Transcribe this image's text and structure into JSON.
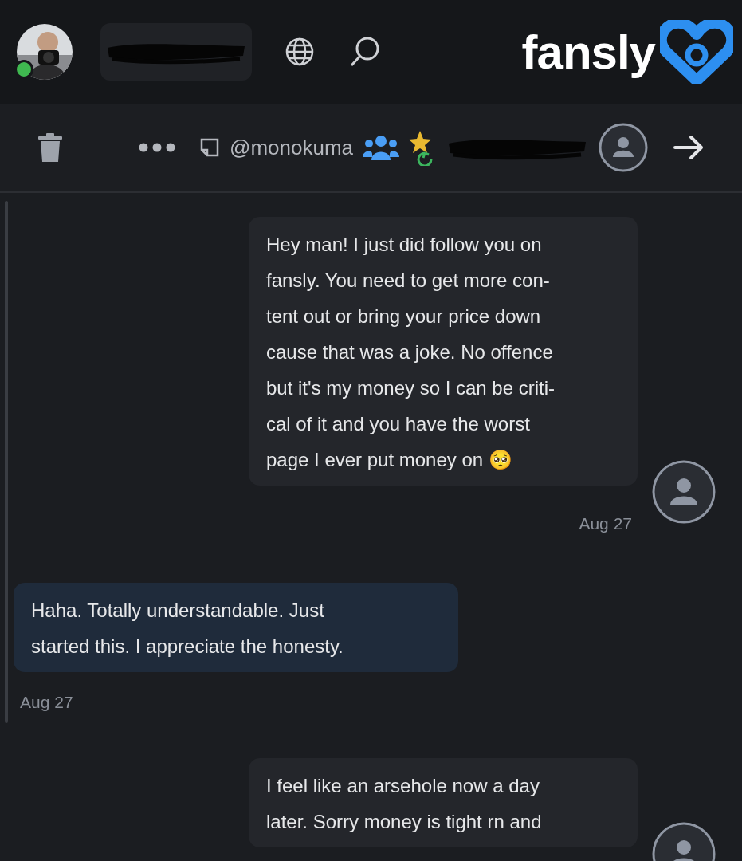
{
  "top_bar": {
    "logo": "fansly",
    "profile": {
      "online": true
    }
  },
  "chat_header": {
    "handle": "@monokuma"
  },
  "messages": [
    {
      "kind": "received",
      "lines": [
        "Hey man! I just did follow you on",
        "fansly. You need to get more con-",
        "tent out or bring your price down",
        "cause that was a joke. No offence",
        "but it's my money so I can be criti-",
        "cal of it and you have the worst",
        "page I ever put money on 🥺"
      ],
      "date": "Aug 27"
    },
    {
      "kind": "sent",
      "lines": [
        "Haha. Totally understandable. Just",
        "started this. I appreciate the honesty."
      ],
      "date": "Aug 27"
    },
    {
      "kind": "received",
      "lines": [
        "I feel like an arsehole now a day",
        "later. Sorry money is tight rn and"
      ]
    }
  ]
}
